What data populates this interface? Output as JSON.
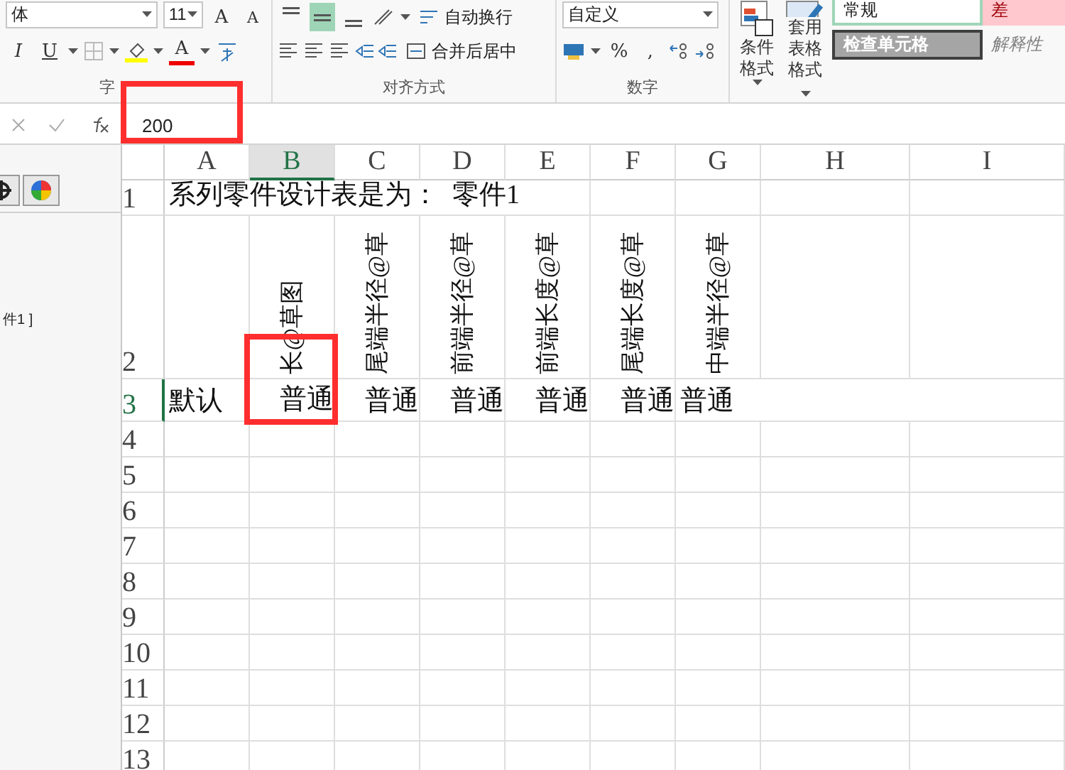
{
  "ribbon": {
    "font": {
      "name": "体",
      "size": "11",
      "grow": "A",
      "shrink": "A",
      "italic": "I",
      "underline": "U",
      "font_color": "A",
      "label": "字"
    },
    "alignment": {
      "vertical": [
        {
          "kind": "top",
          "selected": false
        },
        {
          "kind": "middle",
          "selected": true
        },
        {
          "kind": "bottom",
          "selected": false
        }
      ],
      "wrap": "自动换行",
      "merge": "合并后居中",
      "label": "对齐方式"
    },
    "number": {
      "format": "自定义",
      "percent": "%",
      "comma": ",",
      "label": "数字"
    },
    "styles": {
      "conditional": "条件格式",
      "table_format": [
        "套用",
        "表格格式"
      ],
      "cells": [
        {
          "kind": "normal",
          "label": "常规"
        },
        {
          "kind": "bad",
          "label": "差"
        },
        {
          "kind": "check",
          "label": "检查单元格"
        },
        {
          "kind": "explanatory",
          "label": "解释性"
        }
      ]
    }
  },
  "formula_bar": {
    "value": "200"
  },
  "side_panel": {
    "text": "件1 ]"
  },
  "sheet": {
    "columns": [
      {
        "label": "A",
        "selected": false
      },
      {
        "label": "B",
        "selected": true
      },
      {
        "label": "C",
        "selected": false
      },
      {
        "label": "D",
        "selected": false
      },
      {
        "label": "E",
        "selected": false
      },
      {
        "label": "F",
        "selected": false
      },
      {
        "label": "G",
        "selected": false
      },
      {
        "label": "H",
        "selected": false
      },
      {
        "label": "I",
        "selected": false
      }
    ],
    "rows": [
      {
        "label": "1",
        "selected": false,
        "kind": "normal",
        "cells": [
          {
            "text": "系列零件设计表是为：  零件1",
            "selected": false
          }
        ]
      },
      {
        "label": "2",
        "selected": false,
        "kind": "rotated",
        "cells": [
          {
            "selected": false
          },
          {
            "text": "长@草图",
            "selected": false
          },
          {
            "text": "尾端半径@草",
            "selected": false
          },
          {
            "text": "前端半径@草",
            "selected": false
          },
          {
            "text": "前端长度@草",
            "selected": false
          },
          {
            "text": "尾端长度@草",
            "selected": false
          },
          {
            "text": "中端半径@草",
            "selected": false
          }
        ]
      },
      {
        "label": "3",
        "selected": true,
        "kind": "normal",
        "cells": [
          {
            "text": "默认",
            "selected": false
          },
          {
            "text": "普通",
            "selected": true
          },
          {
            "text": "普通",
            "selected": false
          },
          {
            "text": "普通",
            "selected": false
          },
          {
            "text": "普通",
            "selected": false
          },
          {
            "text": "普通",
            "selected": false
          },
          {
            "text": "普通",
            "selected": false
          }
        ]
      },
      {
        "label": "4",
        "selected": false
      },
      {
        "label": "5",
        "selected": false
      },
      {
        "label": "6",
        "selected": false
      },
      {
        "label": "7",
        "selected": false
      },
      {
        "label": "8",
        "selected": false
      },
      {
        "label": "9",
        "selected": false
      },
      {
        "label": "10",
        "selected": false
      },
      {
        "label": "11",
        "selected": false
      },
      {
        "label": "12",
        "selected": false
      },
      {
        "label": "13",
        "selected": false
      }
    ]
  }
}
